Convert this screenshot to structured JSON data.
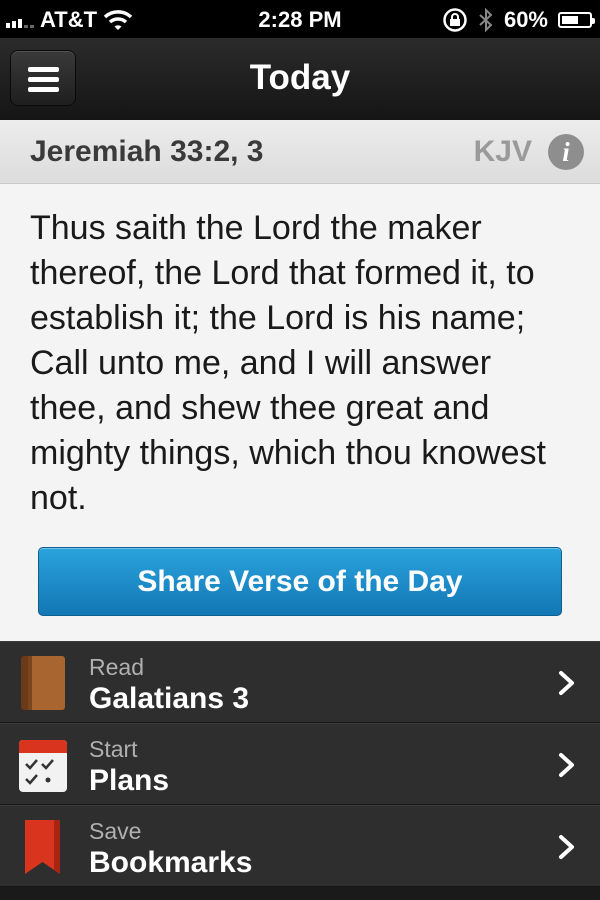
{
  "status_bar": {
    "carrier": "AT&T",
    "time": "2:28 PM",
    "battery": "60%",
    "battery_level": 0.6,
    "icons": [
      "signal-icon",
      "wifi-icon",
      "rotation-lock-icon",
      "bluetooth-icon",
      "battery-icon"
    ]
  },
  "nav": {
    "title": "Today",
    "menu_icon": "hamburger-menu-icon"
  },
  "verse": {
    "reference": "Jeremiah 33:2, 3",
    "version": "KJV",
    "info_icon_label": "i",
    "text": "Thus saith the Lord the maker thereof, the Lord that formed it, to establish it; the Lord is his name; Call unto me, and I will answer thee, and shew thee great and mighty things, which thou knowest not.",
    "share_label": "Share Verse of the Day"
  },
  "menu": {
    "items": [
      {
        "small": "Read",
        "large": "Galatians 3",
        "icon": "book-icon"
      },
      {
        "small": "Start",
        "large": "Plans",
        "icon": "calendar-checklist-icon"
      },
      {
        "small": "Save",
        "large": "Bookmarks",
        "icon": "bookmark-icon"
      }
    ]
  },
  "colors": {
    "accent_blue": "#1a8ccc",
    "dark_background": "#2e2e2e",
    "card_background": "#f4f4f4",
    "bookmark_red": "#d9341e",
    "book_brown": "#9a5a2e"
  }
}
